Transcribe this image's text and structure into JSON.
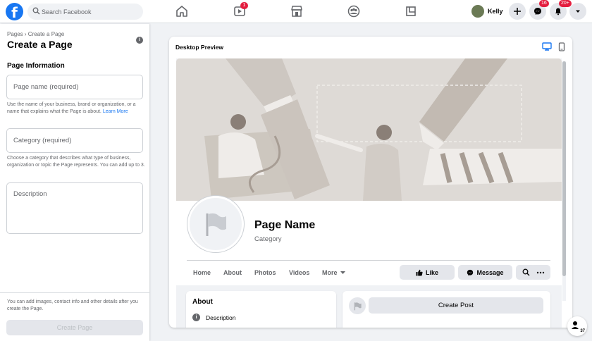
{
  "topnav": {
    "logo": "f",
    "search_placeholder": "Search Facebook",
    "watch_badge": "1",
    "user_name": "Kelly",
    "messenger_badge": "16",
    "notifications_badge": "20+"
  },
  "left": {
    "breadcrumb": "Pages › Create a Page",
    "title": "Create a Page",
    "section": "Page Information",
    "page_name_placeholder": "Page name (required)",
    "page_name_help": "Use the name of your business, brand or organization, or a name that explains what the Page is about.",
    "learn_more": "Learn More",
    "category_placeholder": "Category (required)",
    "category_help": "Choose a category that describes what type of business, organization or topic the Page represents. You can add up to 3.",
    "description_placeholder": "Description",
    "bottom_note": "You can add images, contact info and other details after you create the Page.",
    "create_button": "Create Page"
  },
  "preview": {
    "title": "Desktop Preview",
    "page_name": "Page Name",
    "category": "Category",
    "tabs": [
      "Home",
      "About",
      "Photos",
      "Videos",
      "More"
    ],
    "like_label": "Like",
    "message_label": "Message",
    "about_title": "About",
    "about_description": "Description",
    "create_post": "Create Post"
  },
  "contacts_count": "37",
  "colors": {
    "brand": "#1877f2",
    "badge": "#e41e3f",
    "page_bg": "#f0f2f5",
    "cover_bg": "#dedad6"
  },
  "icons": [
    "search-icon",
    "home-icon",
    "watch-icon",
    "marketplace-icon",
    "groups-icon",
    "gaming-icon",
    "plus-icon",
    "messenger-icon",
    "bell-icon",
    "caret-down-icon",
    "info-icon",
    "desktop-icon",
    "mobile-icon",
    "flag-icon",
    "thumbs-up-icon",
    "messenger-icon",
    "search-icon",
    "more-icon",
    "contacts-icon"
  ]
}
